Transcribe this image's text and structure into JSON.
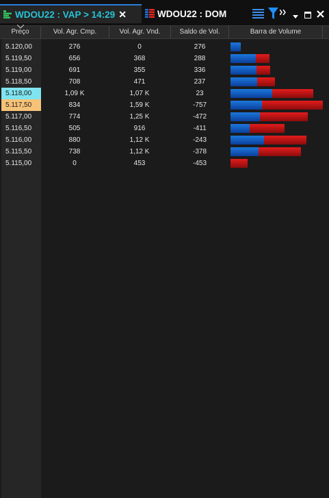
{
  "tabs": [
    {
      "title": "WDOU22 : VAP > 14:29",
      "icon": "vap-chart-icon",
      "active": true,
      "close": "✕"
    },
    {
      "title": "WDOU22 : DOM",
      "icon": "dom-book-icon",
      "active": false
    }
  ],
  "toolbar_icons": [
    "list-view-icon",
    "filter-icon",
    "overflow-chevron-icon",
    "dropdown-arrow-icon",
    "maximize-icon",
    "close-icon"
  ],
  "columns": [
    "Preço",
    "Vol. Agr. Cmp.",
    "Vol. Agr. Vnd.",
    "Saldo de Vol.",
    "Barra de Volume"
  ],
  "rows": [
    {
      "price": "5.120,00",
      "cmp": "276",
      "vnd": "0",
      "saldo": "276",
      "buy_vol": 276,
      "sell_vol": 0,
      "highlight": ""
    },
    {
      "price": "5.119,50",
      "cmp": "656",
      "vnd": "368",
      "saldo": "288",
      "buy_vol": 656,
      "sell_vol": 368,
      "highlight": ""
    },
    {
      "price": "5.119,00",
      "cmp": "691",
      "vnd": "355",
      "saldo": "336",
      "buy_vol": 691,
      "sell_vol": 355,
      "highlight": ""
    },
    {
      "price": "5.118,50",
      "cmp": "708",
      "vnd": "471",
      "saldo": "237",
      "buy_vol": 708,
      "sell_vol": 471,
      "highlight": ""
    },
    {
      "price": "5.118,00",
      "cmp": "1,09 K",
      "vnd": "1,07 K",
      "saldo": "23",
      "buy_vol": 1090,
      "sell_vol": 1070,
      "highlight": "cyan"
    },
    {
      "price": "5.117,50",
      "cmp": "834",
      "vnd": "1,59 K",
      "saldo": "-757",
      "buy_vol": 834,
      "sell_vol": 1590,
      "highlight": "orange"
    },
    {
      "price": "5.117,00",
      "cmp": "774",
      "vnd": "1,25 K",
      "saldo": "-472",
      "buy_vol": 774,
      "sell_vol": 1250,
      "highlight": ""
    },
    {
      "price": "5.116,50",
      "cmp": "505",
      "vnd": "916",
      "saldo": "-411",
      "buy_vol": 505,
      "sell_vol": 916,
      "highlight": ""
    },
    {
      "price": "5.116,00",
      "cmp": "880",
      "vnd": "1,12 K",
      "saldo": "-243",
      "buy_vol": 880,
      "sell_vol": 1120,
      "highlight": ""
    },
    {
      "price": "5.115,50",
      "cmp": "738",
      "vnd": "1,12 K",
      "saldo": "-378",
      "buy_vol": 738,
      "sell_vol": 1120,
      "highlight": ""
    },
    {
      "price": "5.115,00",
      "cmp": "0",
      "vnd": "453",
      "saldo": "-453",
      "buy_vol": 0,
      "sell_vol": 453,
      "highlight": ""
    }
  ],
  "colors": {
    "buy_bar": "#1c78dc",
    "sell_bar": "#e21c1c",
    "active_tab_text": "#27c3d6",
    "highlight_cyan": "#7fe4f0",
    "highlight_orange": "#f6c278"
  }
}
